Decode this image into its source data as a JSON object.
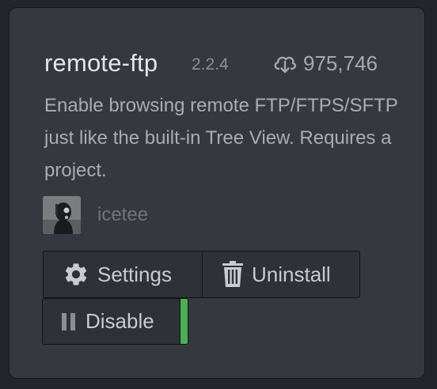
{
  "package": {
    "name": "remote-ftp",
    "version": "2.2.4",
    "download_count": "975,746",
    "download_icon": "cloud-download-icon",
    "description": "Enable browsing remote FTP/FTPS/SFTP just like the built-in Tree View. Requires a project."
  },
  "author": {
    "name": "icetee",
    "avatar_icon": "avatar"
  },
  "actions": {
    "settings_label": "Settings",
    "settings_icon": "gear-icon",
    "uninstall_label": "Uninstall",
    "uninstall_icon": "trash-icon",
    "disable_label": "Disable",
    "disable_icon": "pause-icon"
  },
  "colors": {
    "background": "#22252b",
    "card_background": "#35383f",
    "button_background": "#2e3137",
    "enabled_indicator": "#4caf50",
    "primary_text": "#e4e6eb",
    "muted_text": "#8a8e96"
  }
}
